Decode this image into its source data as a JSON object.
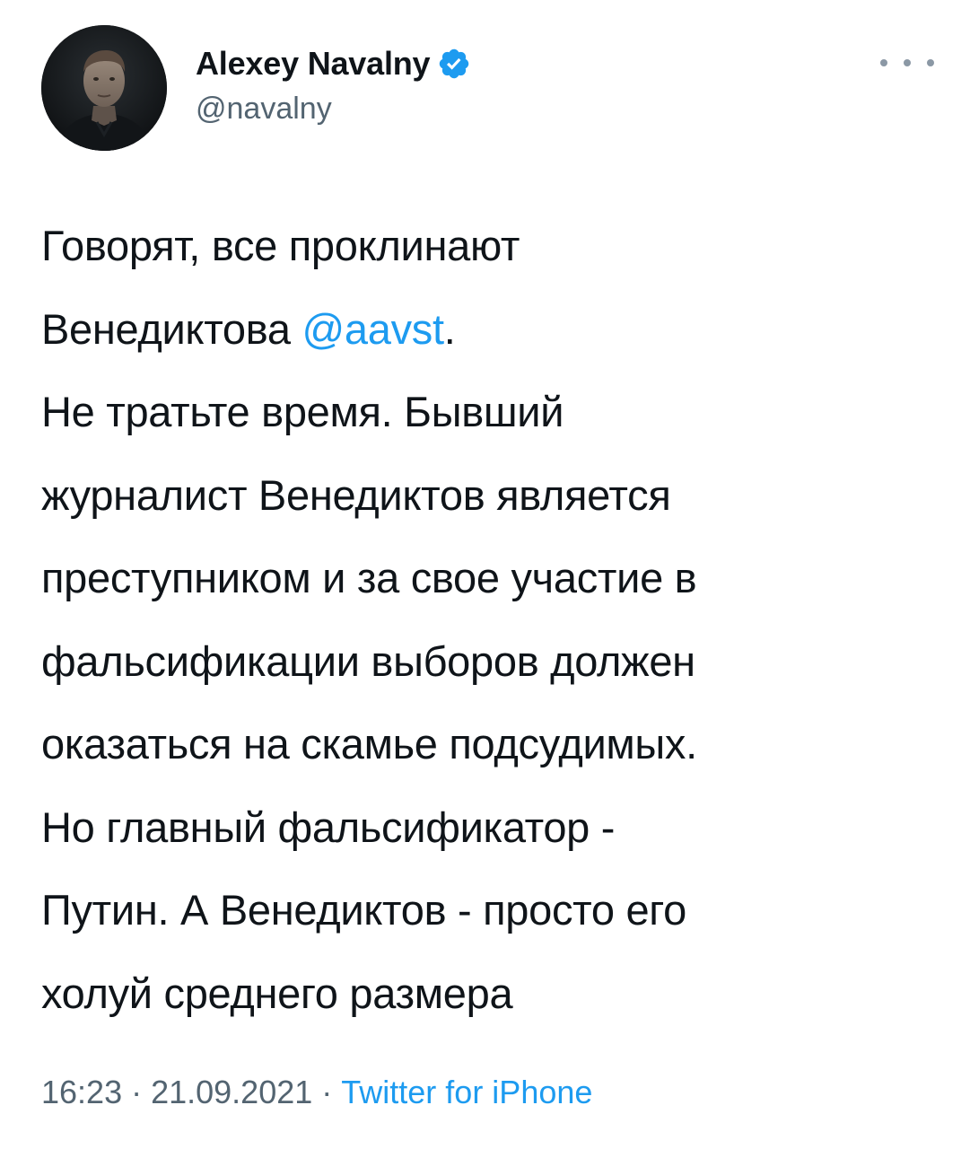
{
  "author": {
    "display_name": "Alexey Navalny",
    "handle": "@navalny",
    "verified_icon": "verified-badge-icon",
    "avatar": "profile-photo"
  },
  "menu": {
    "icon": "more-options-icon"
  },
  "tweet": {
    "line1": "Говорят, все проклинают",
    "line2_prefix": "Венедиктова ",
    "mention": "@aavst",
    "line2_suffix": ".",
    "line3": "Не тратьте время. Бывший",
    "line4": "журналист Венедиктов является",
    "line5": "преступником и за свое участие в",
    "line6": "фальсификации выборов должен",
    "line7": "оказаться на скамье подсудимых.",
    "line8": "Но главный фальсификатор -",
    "line9": "Путин. А Венедиктов - просто его",
    "line10": "холуй среднего размера"
  },
  "meta": {
    "time": "16:23",
    "separator": "·",
    "date": "21.09.2021",
    "source": "Twitter for iPhone"
  },
  "colors": {
    "link": "#1d9bf0",
    "secondary": "#536471",
    "text": "#0f1419"
  }
}
